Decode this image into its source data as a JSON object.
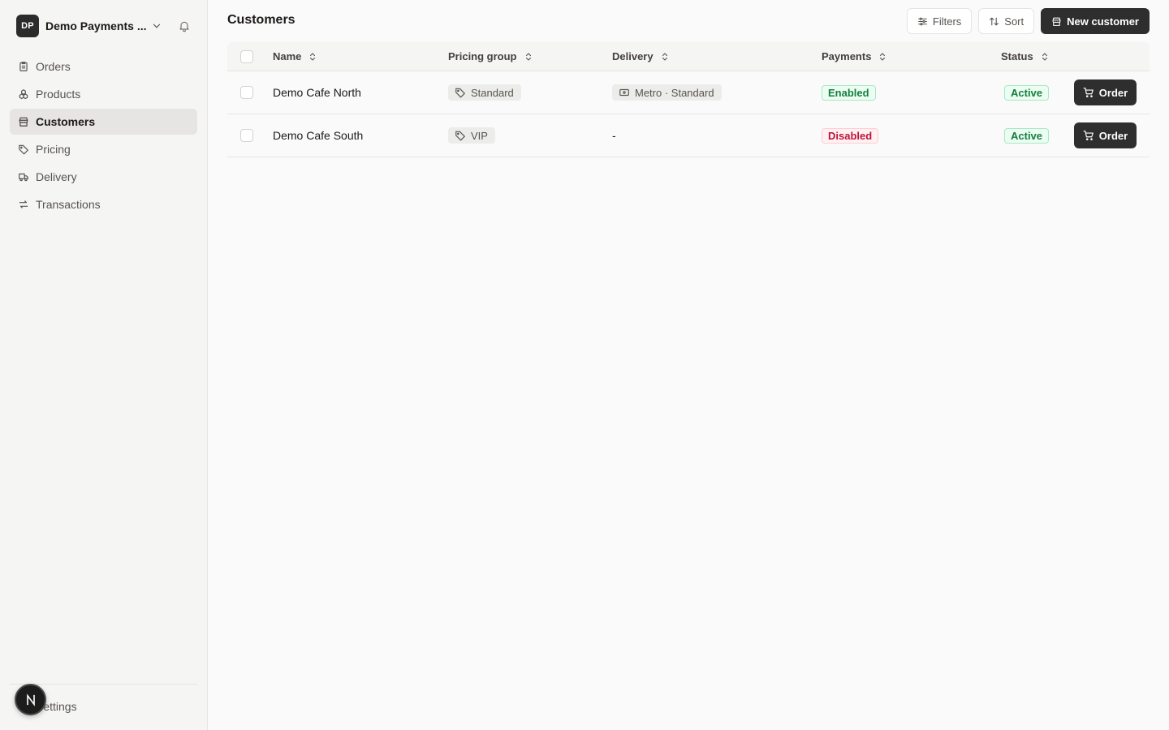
{
  "org": {
    "initials": "DP",
    "name": "Demo Payments ..."
  },
  "nav": {
    "items": [
      {
        "label": "Orders",
        "icon": "clipboard-icon"
      },
      {
        "label": "Products",
        "icon": "boxes-icon"
      },
      {
        "label": "Customers",
        "icon": "store-icon",
        "active": true
      },
      {
        "label": "Pricing",
        "icon": "tag-icon"
      },
      {
        "label": "Delivery",
        "icon": "truck-icon"
      },
      {
        "label": "Transactions",
        "icon": "arrows-swap-icon"
      }
    ],
    "settings_label": "Settings"
  },
  "fab": {
    "letter": "N"
  },
  "page": {
    "title": "Customers"
  },
  "toolbar": {
    "filters_label": "Filters",
    "sort_label": "Sort",
    "new_customer_label": "New customer"
  },
  "table": {
    "columns": [
      "Name",
      "Pricing group",
      "Delivery",
      "Payments",
      "Status"
    ],
    "rows": [
      {
        "name": "Demo Cafe North",
        "pricing_group": "Standard",
        "delivery": "Metro · Standard",
        "payments": "Enabled",
        "status": "Active",
        "action": "Order"
      },
      {
        "name": "Demo Cafe South",
        "pricing_group": "VIP",
        "delivery": "-",
        "payments": "Disabled",
        "status": "Active",
        "action": "Order"
      }
    ]
  },
  "colors": {
    "enabled": "#15803d",
    "disabled": "#be123c",
    "dark_button": "#2e2e2e"
  }
}
